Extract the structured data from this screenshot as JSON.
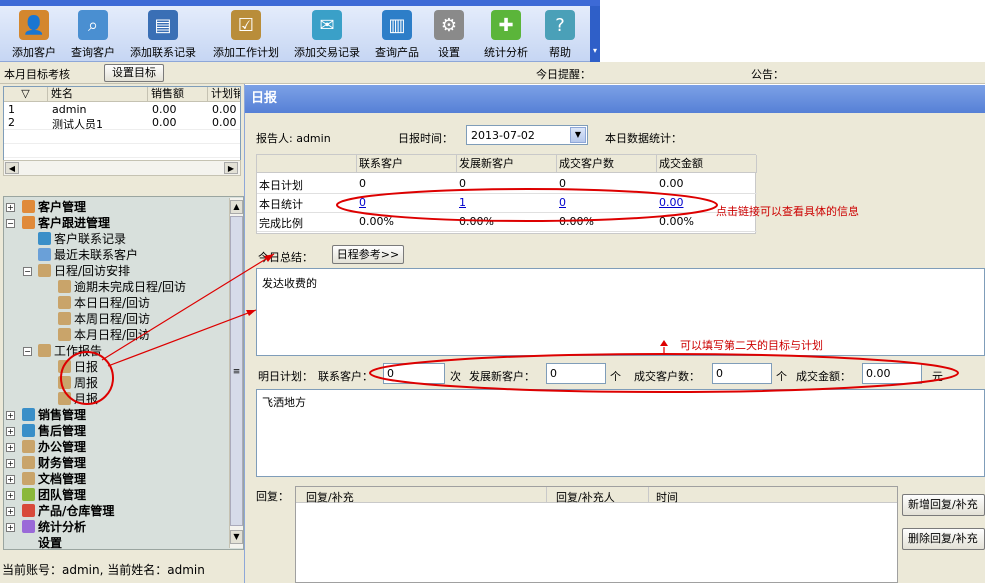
{
  "toolbar": {
    "items": [
      {
        "label": "添加客户",
        "icon": "user-add-icon",
        "color": "#d4872e"
      },
      {
        "label": "查询客户",
        "icon": "magnifier-icon",
        "color": "#4a8fd1"
      },
      {
        "label": "添加联系记录",
        "icon": "card-icon",
        "color": "#3a6fb5"
      },
      {
        "label": "添加工作计划",
        "icon": "clipboard-icon",
        "color": "#b98d3a"
      },
      {
        "label": "添加交易记录",
        "icon": "chat-icon",
        "color": "#3aa0c8"
      },
      {
        "label": "查询产品",
        "icon": "book-icon",
        "color": "#2d7ec8"
      },
      {
        "label": "设置",
        "icon": "gear-icon",
        "color": "#8a8a8a"
      },
      {
        "label": "统计分析",
        "icon": "puzzle-icon",
        "color": "#5bb53a"
      },
      {
        "label": "帮助",
        "icon": "help-book-icon",
        "color": "#4aa0b8"
      }
    ]
  },
  "infobar": {
    "target_label": "本月目标考核",
    "set_target_button": "设置目标",
    "today_reminder": "今日提醒：",
    "notice": "公告："
  },
  "grid": {
    "columns": [
      "▽",
      "姓名",
      "销售额",
      "计划销"
    ],
    "rows": [
      [
        "1",
        "admin",
        "0.00",
        "0.00"
      ],
      [
        "2",
        "测试人员1",
        "0.00",
        "0.00"
      ]
    ]
  },
  "tree": {
    "items": [
      {
        "label": "客户管理",
        "level": 0,
        "bold": true,
        "exp": "+",
        "icon": "users-icon"
      },
      {
        "label": "客户跟进管理",
        "level": 0,
        "bold": true,
        "exp": "-",
        "icon": "users-icon"
      },
      {
        "label": "客户联系记录",
        "level": 1,
        "icon": "chat-icon"
      },
      {
        "label": "最近未联系客户",
        "level": 1,
        "icon": "user-icon"
      },
      {
        "label": "日程/回访安排",
        "level": 1,
        "exp": "-",
        "icon": "calendar-icon"
      },
      {
        "label": "逾期未完成日程/回访",
        "level": 2,
        "icon": "calendar-icon"
      },
      {
        "label": "本日日程/回访",
        "level": 2,
        "icon": "calendar-icon"
      },
      {
        "label": "本周日程/回访",
        "level": 2,
        "icon": "calendar-icon"
      },
      {
        "label": "本月日程/回访",
        "level": 2,
        "icon": "calendar-icon"
      },
      {
        "label": "工作报告",
        "level": 1,
        "exp": "-",
        "icon": "calendar-icon"
      },
      {
        "label": "日报",
        "level": 2,
        "icon": "calendar-icon"
      },
      {
        "label": "周报",
        "level": 2,
        "icon": "calendar-icon"
      },
      {
        "label": "月报",
        "level": 2,
        "icon": "calendar-icon"
      },
      {
        "label": "销售管理",
        "level": 0,
        "bold": true,
        "exp": "+",
        "icon": "chat-icon"
      },
      {
        "label": "售后管理",
        "level": 0,
        "bold": true,
        "exp": "+",
        "icon": "chat-icon"
      },
      {
        "label": "办公管理",
        "level": 0,
        "bold": true,
        "exp": "+",
        "icon": "calendar-icon"
      },
      {
        "label": "财务管理",
        "level": 0,
        "bold": true,
        "exp": "+",
        "icon": "calendar-icon"
      },
      {
        "label": "文档管理",
        "level": 0,
        "bold": true,
        "exp": "+",
        "icon": "calendar-icon"
      },
      {
        "label": "团队管理",
        "level": 0,
        "bold": true,
        "exp": "+",
        "icon": "team-icon"
      },
      {
        "label": "产品/仓库管理",
        "level": 0,
        "bold": true,
        "exp": "+",
        "icon": "globe-icon"
      },
      {
        "label": "统计分析",
        "level": 0,
        "bold": true,
        "exp": "+",
        "icon": "chart-icon"
      },
      {
        "label": "设置",
        "level": 0,
        "bold": true,
        "icon": ""
      }
    ]
  },
  "status": "当前账号：admin, 当前姓名：admin",
  "dialog": {
    "title": "日报",
    "reporter": "报告人: admin",
    "date_label": "日报时间：",
    "date_value": "2013-07-02",
    "stats_label": "本日数据统计：",
    "stat_columns": [
      "",
      "联系客户",
      "发展新客户",
      "成交客户数",
      "成交金额"
    ],
    "stat_rows": [
      {
        "label": "本日计划",
        "values": [
          "0",
          "0",
          "0",
          "0.00"
        ],
        "links": false
      },
      {
        "label": "本日统计",
        "values": [
          "0",
          "1",
          "0",
          "0.00"
        ],
        "links": true
      },
      {
        "label": "完成比例",
        "values": [
          "0.00%",
          "0.00%",
          "0.00%",
          "0.00%"
        ],
        "links": false
      }
    ],
    "summary_label": "今日总结：",
    "schedule_ref_button": "日程参考>>",
    "summary_text": "发达收费的",
    "tomorrow_label": "明日计划：",
    "contact_label": "联系客户：",
    "contact_value": "0",
    "contact_unit": "次",
    "newcust_label": "发展新客户：",
    "newcust_value": "0",
    "newcust_unit": "个",
    "deal_label": "成交客户数：",
    "deal_value": "0",
    "deal_unit": "个",
    "amount_label": "成交金额：",
    "amount_value": "0.00",
    "amount_unit": "元",
    "plan_text": "飞洒地方",
    "reply_label": "回复：",
    "reply_columns": [
      "回复/补充",
      "回复/补充人",
      "时间"
    ],
    "add_reply_button": "新增回复/补充",
    "del_reply_button": "删除回复/补充"
  },
  "annotations": {
    "click_link_note": "点击链接可以查看具体的信息",
    "fill_plan_note": "可以填写第二天的目标与计划"
  }
}
